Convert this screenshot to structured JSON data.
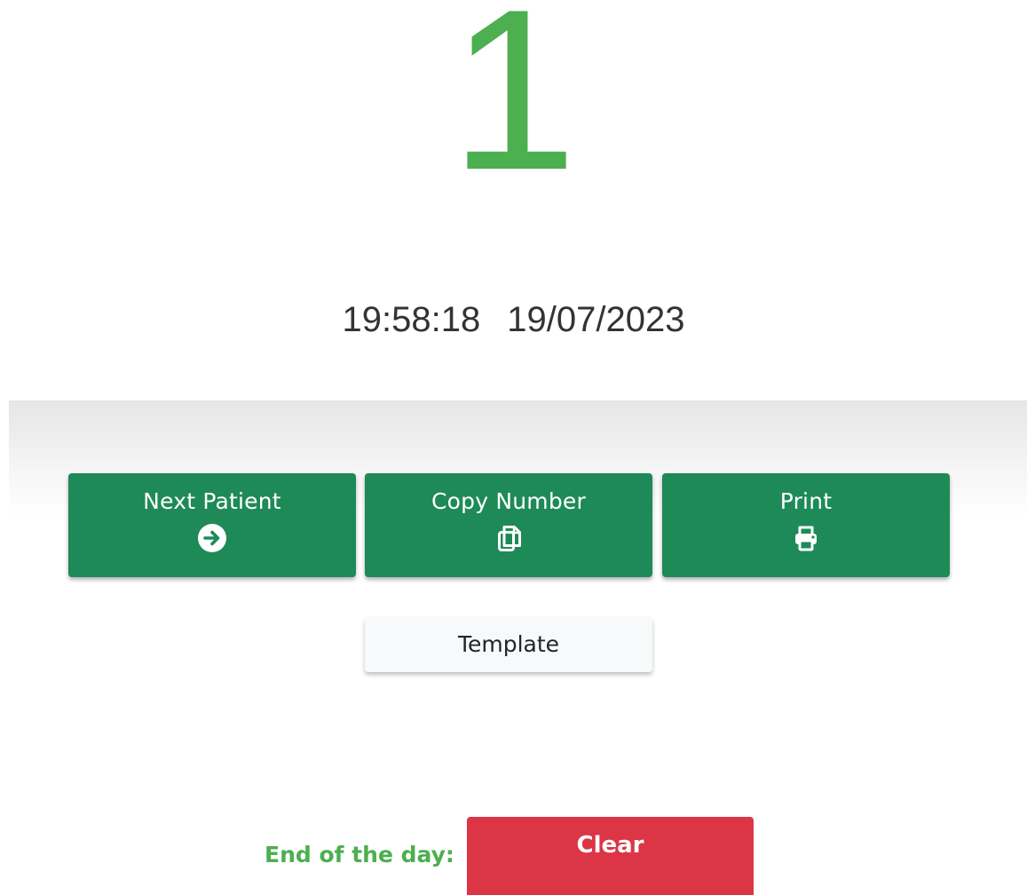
{
  "display": {
    "queue_number": "1",
    "time": "19:58:18",
    "date": "19/07/2023"
  },
  "actions": {
    "next_patient": {
      "label": "Next Patient",
      "icon": "arrow-circle-right-icon"
    },
    "copy_number": {
      "label": "Copy Number",
      "icon": "copy-icon"
    },
    "print": {
      "label": "Print",
      "icon": "printer-icon"
    },
    "template": {
      "label": "Template"
    }
  },
  "end_of_day": {
    "label": "End of the day:",
    "clear_label": "Clear"
  },
  "colors": {
    "number_green": "#4caf50",
    "button_green": "#1e8a57",
    "clear_red": "#dc3545",
    "template_bg": "#f8f9fa",
    "text_dark": "#333333"
  }
}
